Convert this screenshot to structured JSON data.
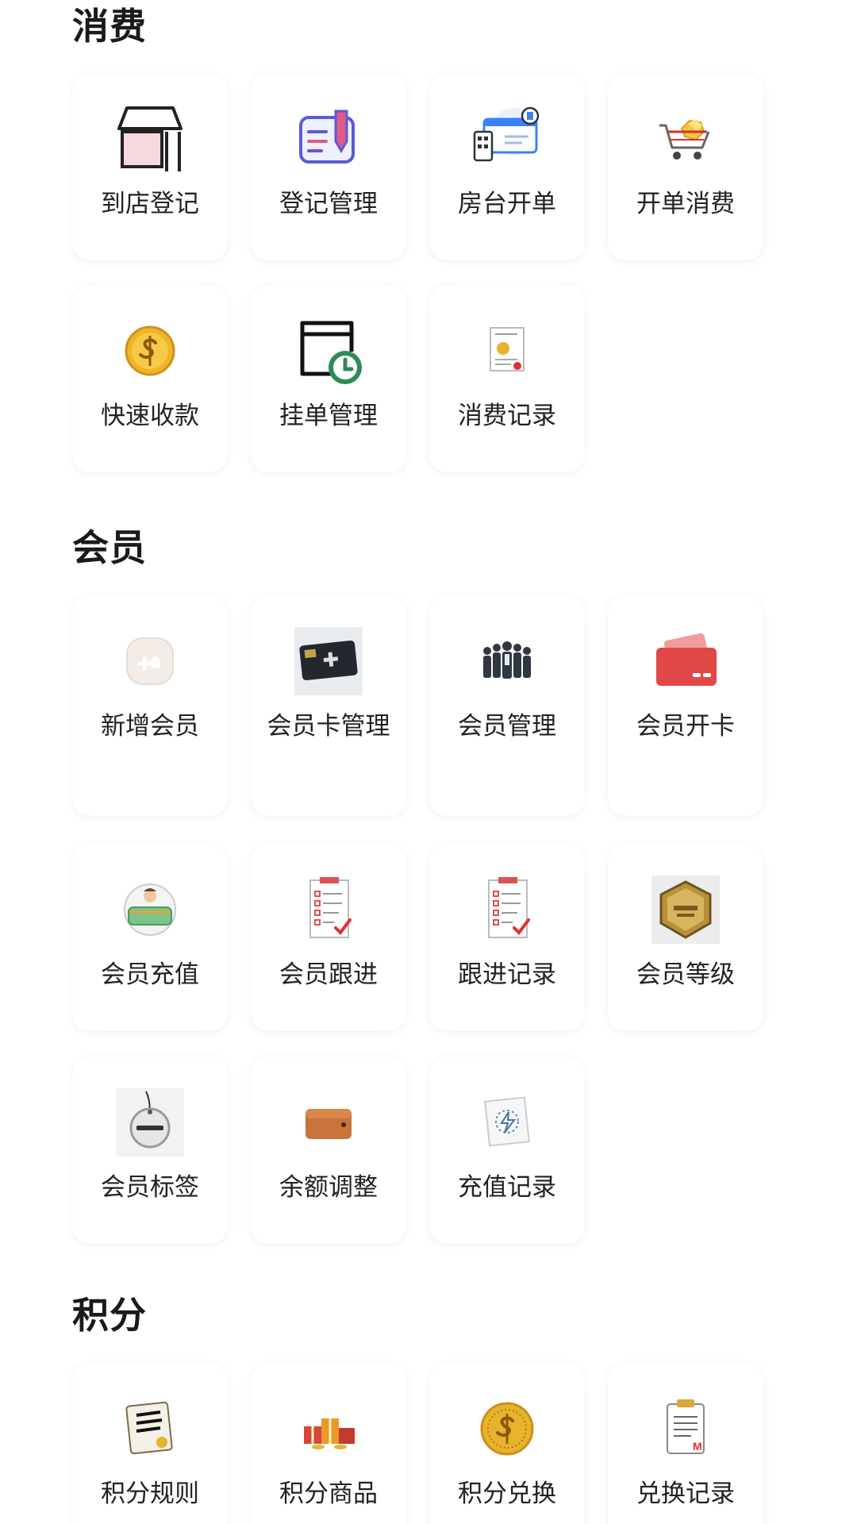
{
  "sections": [
    {
      "title": "消费",
      "items": [
        {
          "label": "到店登记",
          "icon": "storefront-icon"
        },
        {
          "label": "登记管理",
          "icon": "register-edit-icon"
        },
        {
          "label": "房台开单",
          "icon": "qr-order-icon"
        },
        {
          "label": "开单消费",
          "icon": "shopping-cart-icon"
        },
        {
          "label": "快速收款",
          "icon": "dollar-coin-icon"
        },
        {
          "label": "挂单管理",
          "icon": "pending-order-clock-icon"
        },
        {
          "label": "消费记录",
          "icon": "receipt-document-icon"
        }
      ]
    },
    {
      "title": "会员",
      "items": [
        {
          "label": "新增会员",
          "icon": "add-member-icon"
        },
        {
          "label": "会员卡管理",
          "icon": "member-card-icon"
        },
        {
          "label": "会员管理",
          "icon": "people-group-icon"
        },
        {
          "label": "会员开卡",
          "icon": "credit-card-icon"
        },
        {
          "label": "会员充值",
          "icon": "money-recharge-icon"
        },
        {
          "label": "会员跟进",
          "icon": "checklist-document-icon"
        },
        {
          "label": "跟进记录",
          "icon": "checklist-document-icon"
        },
        {
          "label": "会员等级",
          "icon": "gold-level-badge-icon"
        },
        {
          "label": "会员标签",
          "icon": "member-tag-icon"
        },
        {
          "label": "余额调整",
          "icon": "wallet-icon"
        },
        {
          "label": "充值记录",
          "icon": "lightning-card-icon"
        }
      ]
    },
    {
      "title": "积分",
      "items": [
        {
          "label": "积分规则",
          "icon": "rule-book-icon"
        },
        {
          "label": "积分商品",
          "icon": "gift-boxes-icon"
        },
        {
          "label": "积分兑换",
          "icon": "gold-coin-icon"
        },
        {
          "label": "兑换记录",
          "icon": "clipboard-list-icon"
        }
      ]
    }
  ],
  "colors": {
    "tile_background": "#ffffff",
    "page_background": "#ffffff",
    "card_red": "#e04848",
    "qr_blue": "#3b82f6",
    "coin_gold": "#e8b22c",
    "clock_green": "#2e8b57",
    "edit_purple": "#5b5bd6"
  }
}
